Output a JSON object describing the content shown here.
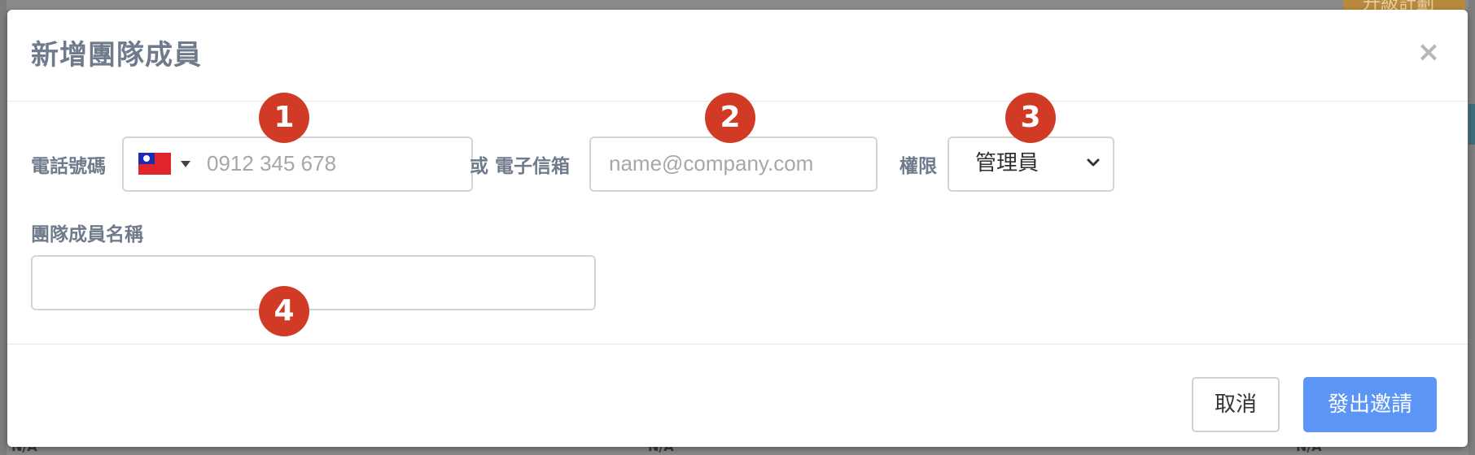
{
  "background": {
    "upgrade_label": "升級計劃",
    "na_label": "N/A"
  },
  "modal": {
    "title": "新增團隊成員",
    "close_glyph": "×"
  },
  "form": {
    "phone": {
      "label": "電話號碼",
      "country_flag": "taiwan-flag-icon",
      "placeholder": "0912 345 678",
      "value": ""
    },
    "or_email": {
      "label": "或 電子信箱",
      "placeholder": "name@company.com",
      "value": ""
    },
    "permission": {
      "label": "權限",
      "selected": "管理員"
    },
    "member_name": {
      "label": "團隊成員名稱",
      "value": ""
    }
  },
  "badges": [
    "1",
    "2",
    "3",
    "4"
  ],
  "footer": {
    "cancel_label": "取消",
    "submit_label": "發出邀請"
  },
  "colors": {
    "title": "#6f7b8c",
    "badge": "#d13b26",
    "primary": "#5b95f5",
    "flag_red": "#e0252d",
    "flag_blue": "#1f2ab3"
  }
}
